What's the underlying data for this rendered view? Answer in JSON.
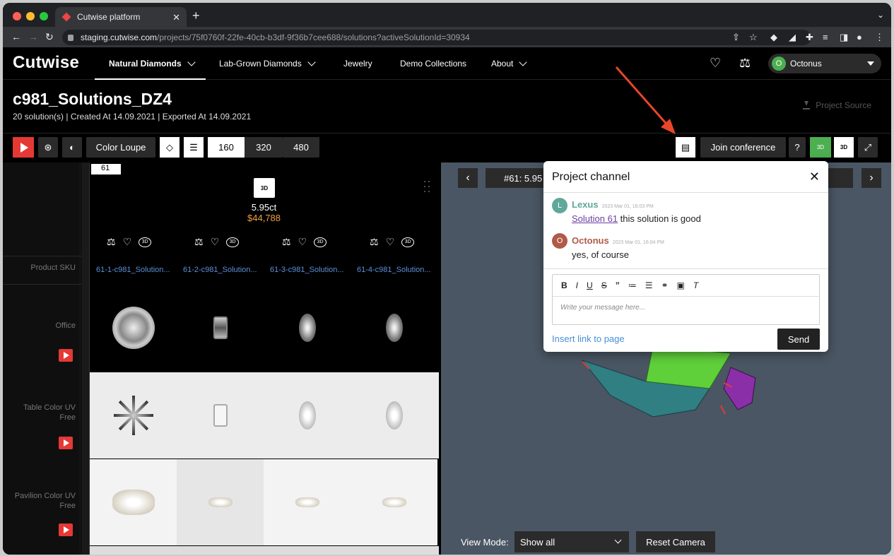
{
  "browser": {
    "tab_title": "Cutwise platform",
    "url_host": "staging.cutwise.com",
    "url_path": "/projects/75f0760f-22fe-40cb-b3df-9f36b7cee688/solutions?activeSolutionId=30934"
  },
  "header": {
    "logo": "Cutwise",
    "nav": [
      "Natural Diamonds",
      "Lab-Grown Diamonds",
      "Jewelry",
      "Demo Collections",
      "About"
    ],
    "user_initial": "O",
    "user_name": "Octonus"
  },
  "project": {
    "title": "c981_Solutions_DZ4",
    "meta": "20 solution(s)  | Created At 14.09.2021  | Exported At 14.09.2021",
    "source_label": "Project Source"
  },
  "toolbar": {
    "color_loupe": "Color Loupe",
    "sizes": [
      "160",
      "320",
      "480"
    ],
    "join_conference": "Join conference",
    "icon_3d": "3D"
  },
  "grid": {
    "row_labels": [
      "Product SKU",
      "Office",
      "Table Color UV Free",
      "Pavilion Color UV Free"
    ],
    "solution_number": "61",
    "carat": "5.95ct",
    "price": "$44,788",
    "skus": [
      "61-1-c981_Solution...",
      "61-2-c981_Solution...",
      "61-3-c981_Solution...",
      "61-4-c981_Solution..."
    ]
  },
  "viewer": {
    "title": "#61: 5.95",
    "view_mode_label": "View Mode:",
    "view_mode_value": "Show all",
    "reset_camera": "Reset Camera"
  },
  "channel": {
    "title": "Project channel",
    "messages": [
      {
        "initial": "L",
        "author": "Lexus",
        "time": "2023 Mar 01, 16:03 PM",
        "link": "Solution 61",
        "text": " this solution is good",
        "color": "#5fa89a"
      },
      {
        "initial": "O",
        "author": "Octonus",
        "time": "2023 Mar 01, 16:04 PM",
        "link": "",
        "text": "yes, of course",
        "color": "#b05a48"
      }
    ],
    "placeholder": "Write your message here...",
    "insert_link": "Insert link to page",
    "send": "Send"
  }
}
